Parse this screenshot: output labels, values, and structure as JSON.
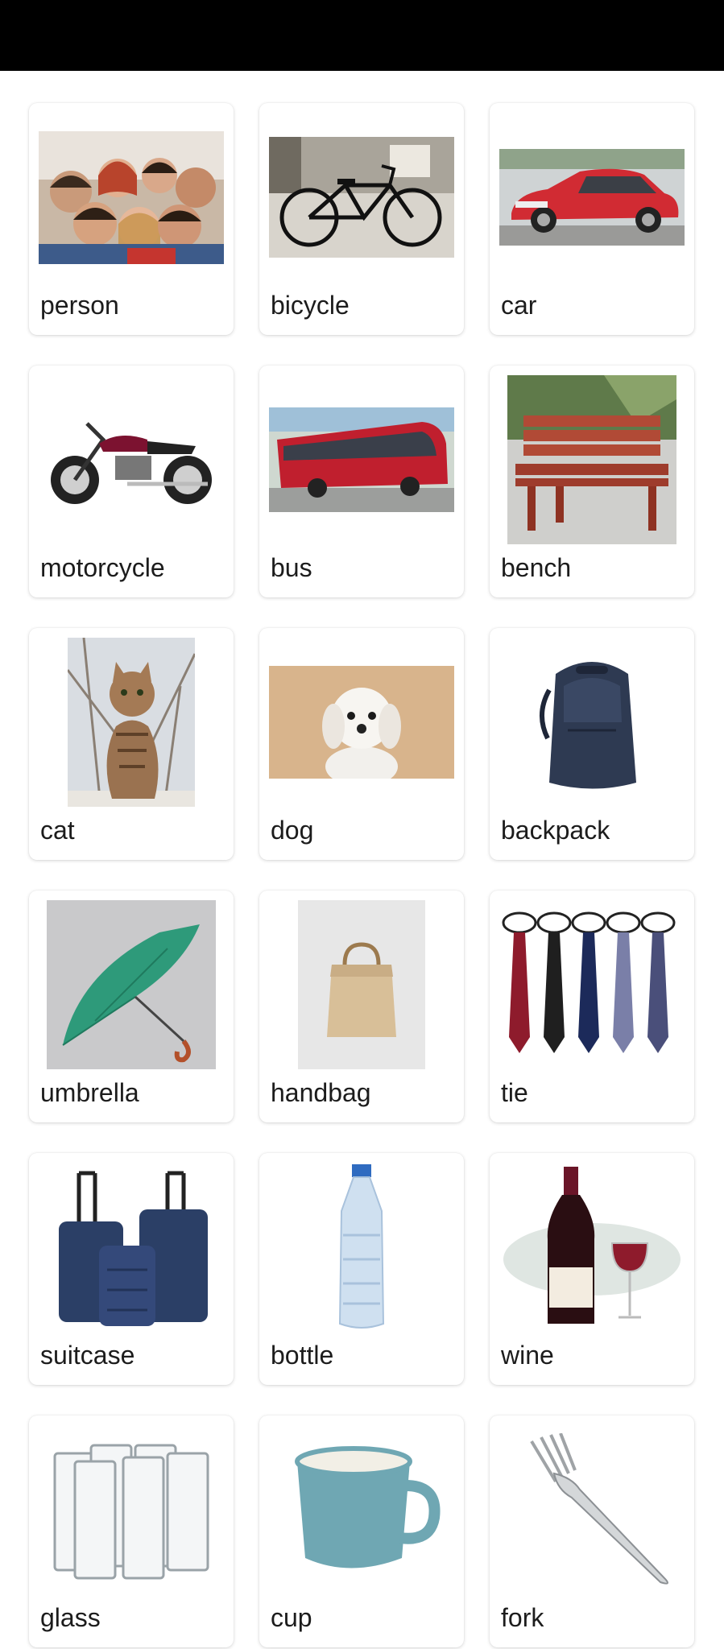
{
  "categories": [
    {
      "label": "person",
      "icon": "person-photo-icon"
    },
    {
      "label": "bicycle",
      "icon": "bicycle-photo-icon"
    },
    {
      "label": "car",
      "icon": "car-photo-icon"
    },
    {
      "label": "motorcycle",
      "icon": "motorcycle-photo-icon"
    },
    {
      "label": "bus",
      "icon": "bus-photo-icon"
    },
    {
      "label": "bench",
      "icon": "bench-photo-icon"
    },
    {
      "label": "cat",
      "icon": "cat-photo-icon"
    },
    {
      "label": "dog",
      "icon": "dog-photo-icon"
    },
    {
      "label": "backpack",
      "icon": "backpack-photo-icon"
    },
    {
      "label": "umbrella",
      "icon": "umbrella-photo-icon"
    },
    {
      "label": "handbag",
      "icon": "handbag-photo-icon"
    },
    {
      "label": "tie",
      "icon": "tie-photo-icon"
    },
    {
      "label": "suitcase",
      "icon": "suitcase-photo-icon"
    },
    {
      "label": "bottle",
      "icon": "bottle-photo-icon"
    },
    {
      "label": "wine",
      "icon": "wine-photo-icon"
    },
    {
      "label": "glass",
      "icon": "glass-photo-icon"
    },
    {
      "label": "cup",
      "icon": "cup-photo-icon"
    },
    {
      "label": "fork",
      "icon": "fork-photo-icon"
    }
  ],
  "colors": {
    "status_bar": "#000000",
    "card_bg": "#ffffff",
    "label_text": "#1c1c1c"
  }
}
